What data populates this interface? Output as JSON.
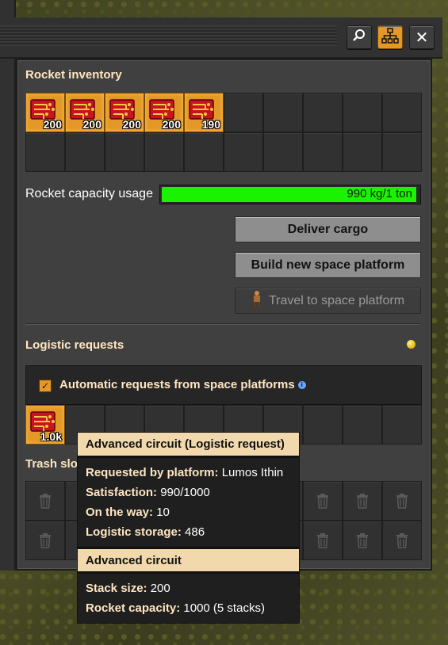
{
  "colors": {
    "accent": "#e39827",
    "progress_green": "#1bf200",
    "header_text": "#ffe6c0",
    "tooltip_head": "#f2d9ad"
  },
  "titlebar": {
    "buttons": [
      {
        "icon": "search-icon"
      },
      {
        "icon": "network-icon"
      },
      {
        "icon": "close-icon",
        "label": "✕"
      }
    ]
  },
  "rocket_inventory": {
    "title": "Rocket inventory",
    "slots": [
      {
        "item": "advanced-circuit-icon",
        "count": "200"
      },
      {
        "item": "advanced-circuit-icon",
        "count": "200"
      },
      {
        "item": "advanced-circuit-icon",
        "count": "200"
      },
      {
        "item": "advanced-circuit-icon",
        "count": "200"
      },
      {
        "item": "advanced-circuit-icon",
        "count": "190"
      },
      {},
      {},
      {},
      {},
      {},
      {},
      {},
      {},
      {},
      {},
      {},
      {},
      {},
      {},
      {}
    ]
  },
  "capacity": {
    "label": "Rocket capacity usage",
    "value_text": "990 kg/1 ton",
    "fraction": 0.99
  },
  "actions": {
    "deliver": "Deliver cargo",
    "build": "Build new space platform",
    "travel": "Travel to space platform"
  },
  "logistic": {
    "title": "Logistic requests",
    "auto_label": "Automatic requests from space platforms",
    "auto_checked": true,
    "slots": [
      {
        "item": "advanced-circuit-icon",
        "count": "1.0k"
      },
      {},
      {},
      {},
      {},
      {},
      {},
      {},
      {},
      {}
    ]
  },
  "trash": {
    "title": "Trash slo"
  },
  "tooltip": {
    "header1": "Advanced circuit (Logistic request)",
    "rows1": [
      {
        "key": "Requested by platform:",
        "value": "Lumos Ithin"
      },
      {
        "key": "Satisfaction:",
        "value": "990/1000"
      },
      {
        "key": "On the way:",
        "value": "10"
      },
      {
        "key": "Logistic storage:",
        "value": "486"
      }
    ],
    "header2": "Advanced circuit",
    "rows2": [
      {
        "key": "Stack size:",
        "value": "200"
      },
      {
        "key": "Rocket capacity:",
        "value": "1000 (5 stacks)"
      }
    ]
  }
}
